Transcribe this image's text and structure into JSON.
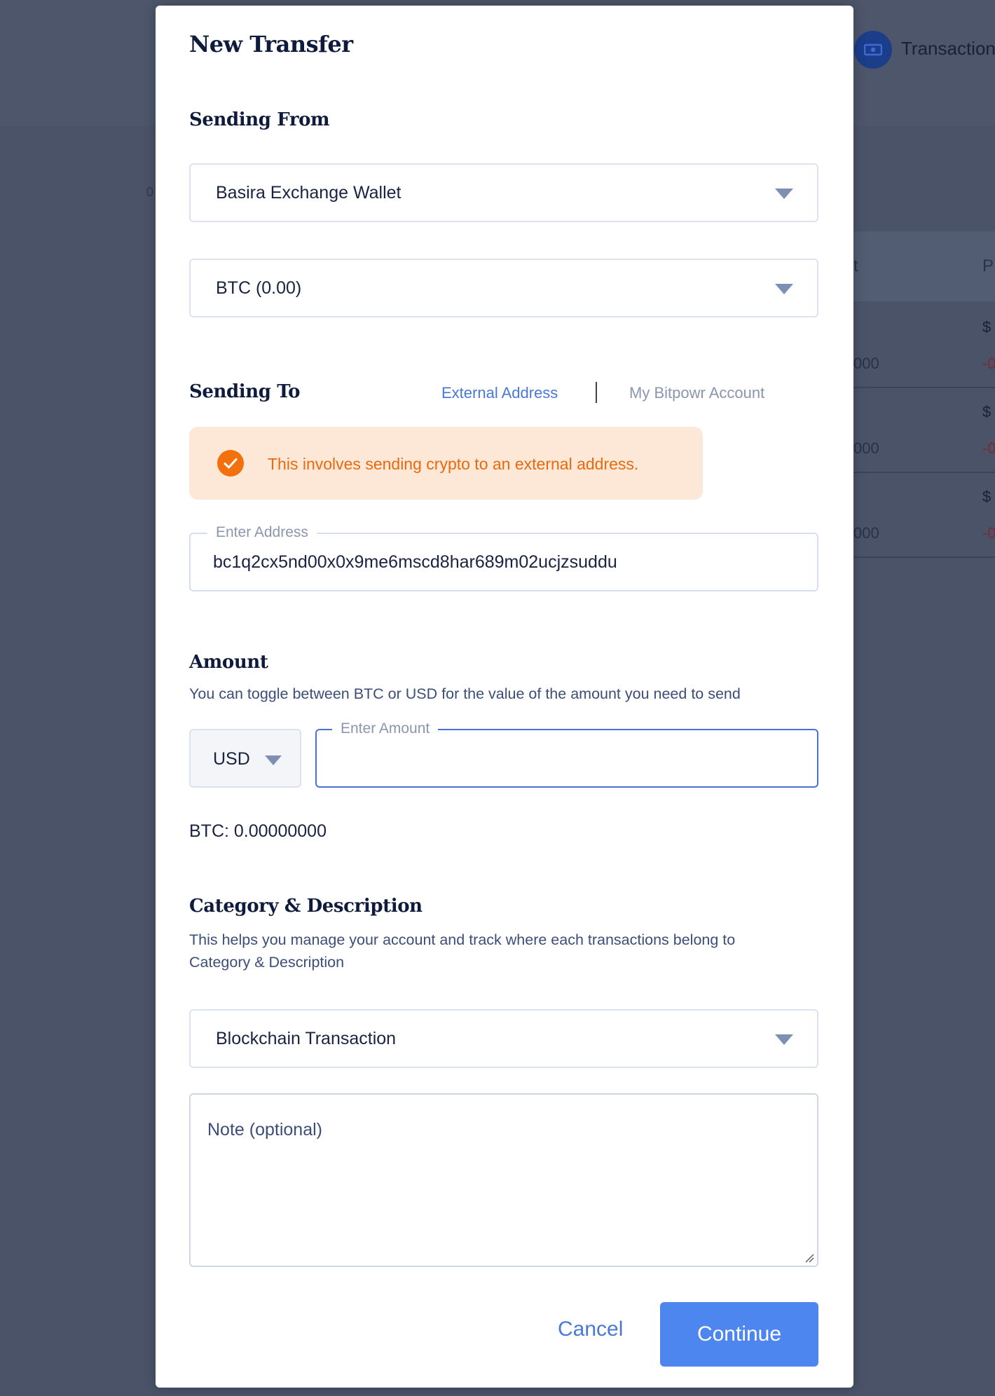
{
  "background": {
    "nav_label": "Transactions",
    "table_headers": [
      "t",
      "P"
    ],
    "rows": [
      {
        "amount": "000",
        "usd": "$",
        "change": "-0"
      },
      {
        "amount": "000",
        "usd": "$",
        "change": "-0"
      },
      {
        "amount": "000",
        "usd": "$",
        "change": "-0"
      }
    ],
    "left_digit": "0"
  },
  "modal": {
    "title": "New Transfer",
    "sending_from": {
      "heading": "Sending From",
      "wallet": "Basira Exchange Wallet",
      "asset": "BTC (0.00)"
    },
    "sending_to": {
      "heading": "Sending To",
      "tabs": {
        "external": "External Address",
        "internal": "My Bitpowr Account"
      },
      "notice": "This involves sending crypto to an external address.",
      "address_label": "Enter Address",
      "address_value": "bc1q2cx5nd00x0x9me6mscd8har689m02ucjzsuddu"
    },
    "amount": {
      "heading": "Amount",
      "help": "You can toggle between BTC or USD for the value of the amount you need to send",
      "currency": "USD",
      "amount_label": "Enter Amount",
      "amount_value": "",
      "btc_equivalent": "BTC: 0.00000000"
    },
    "category": {
      "heading": "Category & Description",
      "help_line1": "This helps you manage your account and track where each transactions belong to",
      "help_line2": "Category & Description",
      "selected": "Blockchain Transaction",
      "note_placeholder": "Note (optional)"
    },
    "actions": {
      "cancel": "Cancel",
      "continue": "Continue"
    }
  },
  "colors": {
    "accent": "#4e86f0",
    "link": "#4a78d9",
    "notice_bg": "#fde8d8",
    "notice_text": "#e86a0c",
    "overlay": "#4a5368"
  }
}
